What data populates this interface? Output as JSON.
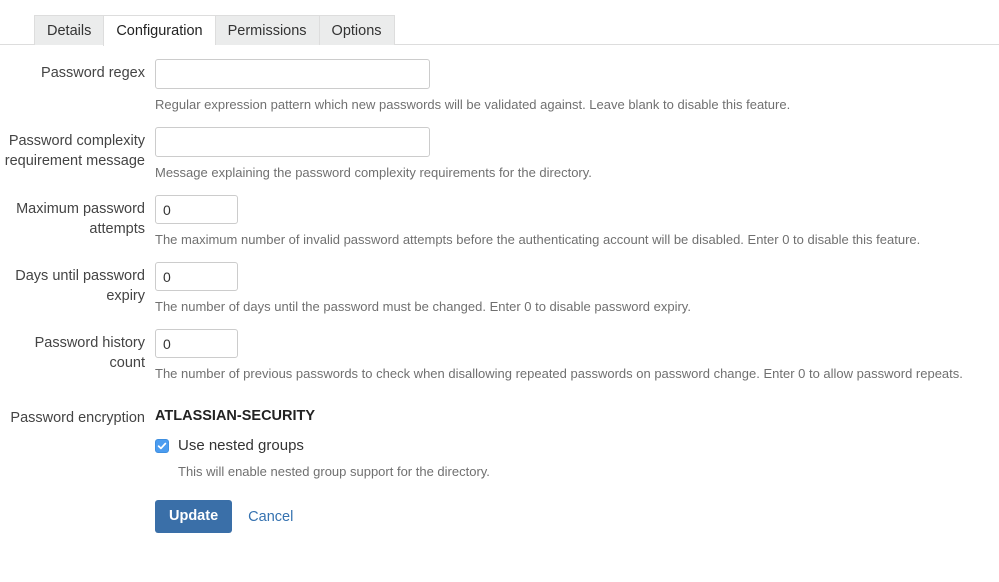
{
  "tabs": [
    {
      "label": "Details",
      "active": false
    },
    {
      "label": "Configuration",
      "active": true
    },
    {
      "label": "Permissions",
      "active": false
    },
    {
      "label": "Options",
      "active": false
    }
  ],
  "form": {
    "fields": [
      {
        "label": "Password regex",
        "value": "",
        "placeholder": "",
        "help": "Regular expression pattern which new passwords will be validated against. Leave blank to disable this feature."
      },
      {
        "label": "Password complexity requirement message",
        "value": "",
        "placeholder": "",
        "help": "Message explaining the password complexity requirements for the directory."
      },
      {
        "label": "Maximum password attempts",
        "value": "0",
        "placeholder": "",
        "help": "The maximum number of invalid password attempts before the authenticating account will be disabled. Enter 0 to disable this feature."
      },
      {
        "label": "Days until password expiry",
        "value": "0",
        "placeholder": "",
        "help": "The number of days until the password must be changed. Enter 0 to disable password expiry."
      },
      {
        "label": "Password history count",
        "value": "0",
        "placeholder": "",
        "help": "The number of previous passwords to check when disallowing repeated passwords on password change. Enter 0 to allow password repeats."
      }
    ],
    "encryption": {
      "label": "Password encryption",
      "value": "ATLASSIAN-SECURITY",
      "nested_groups_label": "Use nested groups",
      "nested_groups_checked": true,
      "nested_groups_help": "This will enable nested group support for the directory."
    },
    "actions": {
      "update_label": "Update",
      "cancel_label": "Cancel"
    }
  },
  "colors": {
    "primary_button": "#3a6fa8",
    "link": "#3572b0",
    "checkbox": "#4b9cf0",
    "input_border": "#cccccc",
    "help_text": "#707070"
  }
}
